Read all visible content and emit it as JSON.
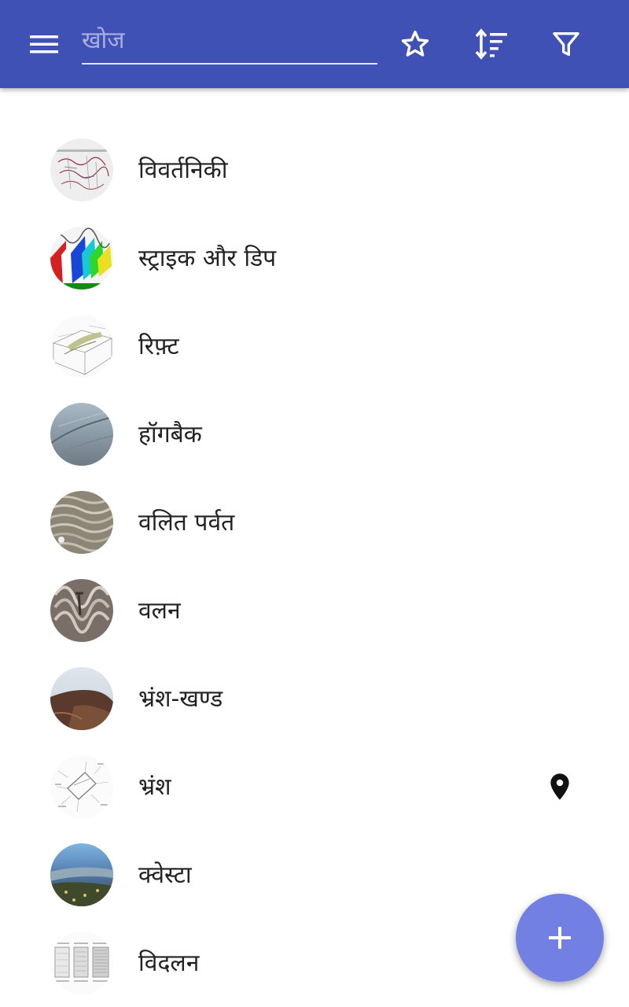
{
  "toolbar": {
    "search_placeholder": "खोज",
    "search_value": "",
    "icons": [
      "menu-icon",
      "star-outline-icon",
      "sort-icon",
      "filter-icon"
    ]
  },
  "colors": {
    "appbar": "#3f51b5",
    "fab": "#7280e4",
    "text": "#222222"
  },
  "items": [
    {
      "label": "विवर्तनिकी",
      "thumb": "world-map-thumbnail",
      "has_pin": false
    },
    {
      "label": "स्ट्राइक और डिप",
      "thumb": "colored-strata-thumbnail",
      "has_pin": false
    },
    {
      "label": "रिफ़्ट",
      "thumb": "rift-diagram-thumbnail",
      "has_pin": false
    },
    {
      "label": "हॉगबैक",
      "thumb": "hogback-photo-thumbnail",
      "has_pin": false
    },
    {
      "label": "वलित पर्वत",
      "thumb": "folded-mountains-photo-thumbnail",
      "has_pin": false
    },
    {
      "label": "वलन",
      "thumb": "rock-fold-photo-thumbnail",
      "has_pin": false
    },
    {
      "label": "भ्रंश-खण्ड",
      "thumb": "fault-block-photo-thumbnail",
      "has_pin": false
    },
    {
      "label": "भ्रंश",
      "thumb": "fault-diagram-thumbnail",
      "has_pin": true
    },
    {
      "label": "क्वेस्टा",
      "thumb": "cuesta-aerial-photo-thumbnail",
      "has_pin": false
    },
    {
      "label": "विदलन",
      "thumb": "cleavage-diagram-thumbnail",
      "has_pin": false
    }
  ],
  "fab": {
    "icon": "plus-icon"
  }
}
